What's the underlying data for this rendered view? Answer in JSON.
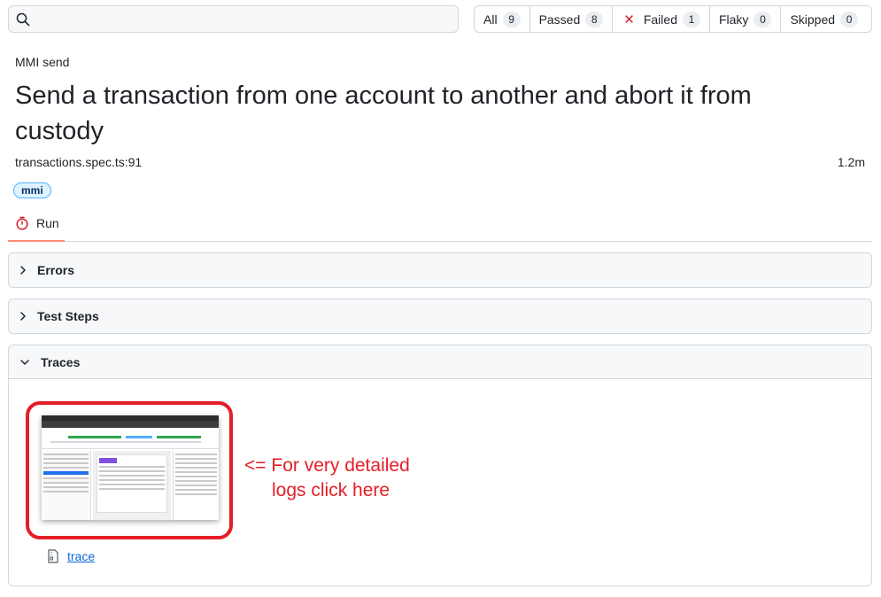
{
  "search": {
    "placeholder": ""
  },
  "filters": [
    {
      "label": "All",
      "count": "9"
    },
    {
      "label": "Passed",
      "count": "8"
    },
    {
      "label": "Failed",
      "count": "1"
    },
    {
      "label": "Flaky",
      "count": "0"
    },
    {
      "label": "Skipped",
      "count": "0"
    }
  ],
  "header": {
    "suite": "MMI send",
    "title": "Send a transaction from one account to another and abort it from custody",
    "file": "transactions.spec.ts:91",
    "duration": "1.2m",
    "tag": "mmi"
  },
  "tabs": [
    {
      "label": "Run"
    }
  ],
  "panels": {
    "errors": "Errors",
    "test_steps": "Test Steps",
    "traces": "Traces"
  },
  "annotation": {
    "line1": "<= For very detailed",
    "line2": "logs click here"
  },
  "trace_link": "trace",
  "colors": {
    "accent_red": "#e41e26",
    "link": "#0969da",
    "tag_bg": "#ddf4ff",
    "failed_x": "#cf222e"
  }
}
